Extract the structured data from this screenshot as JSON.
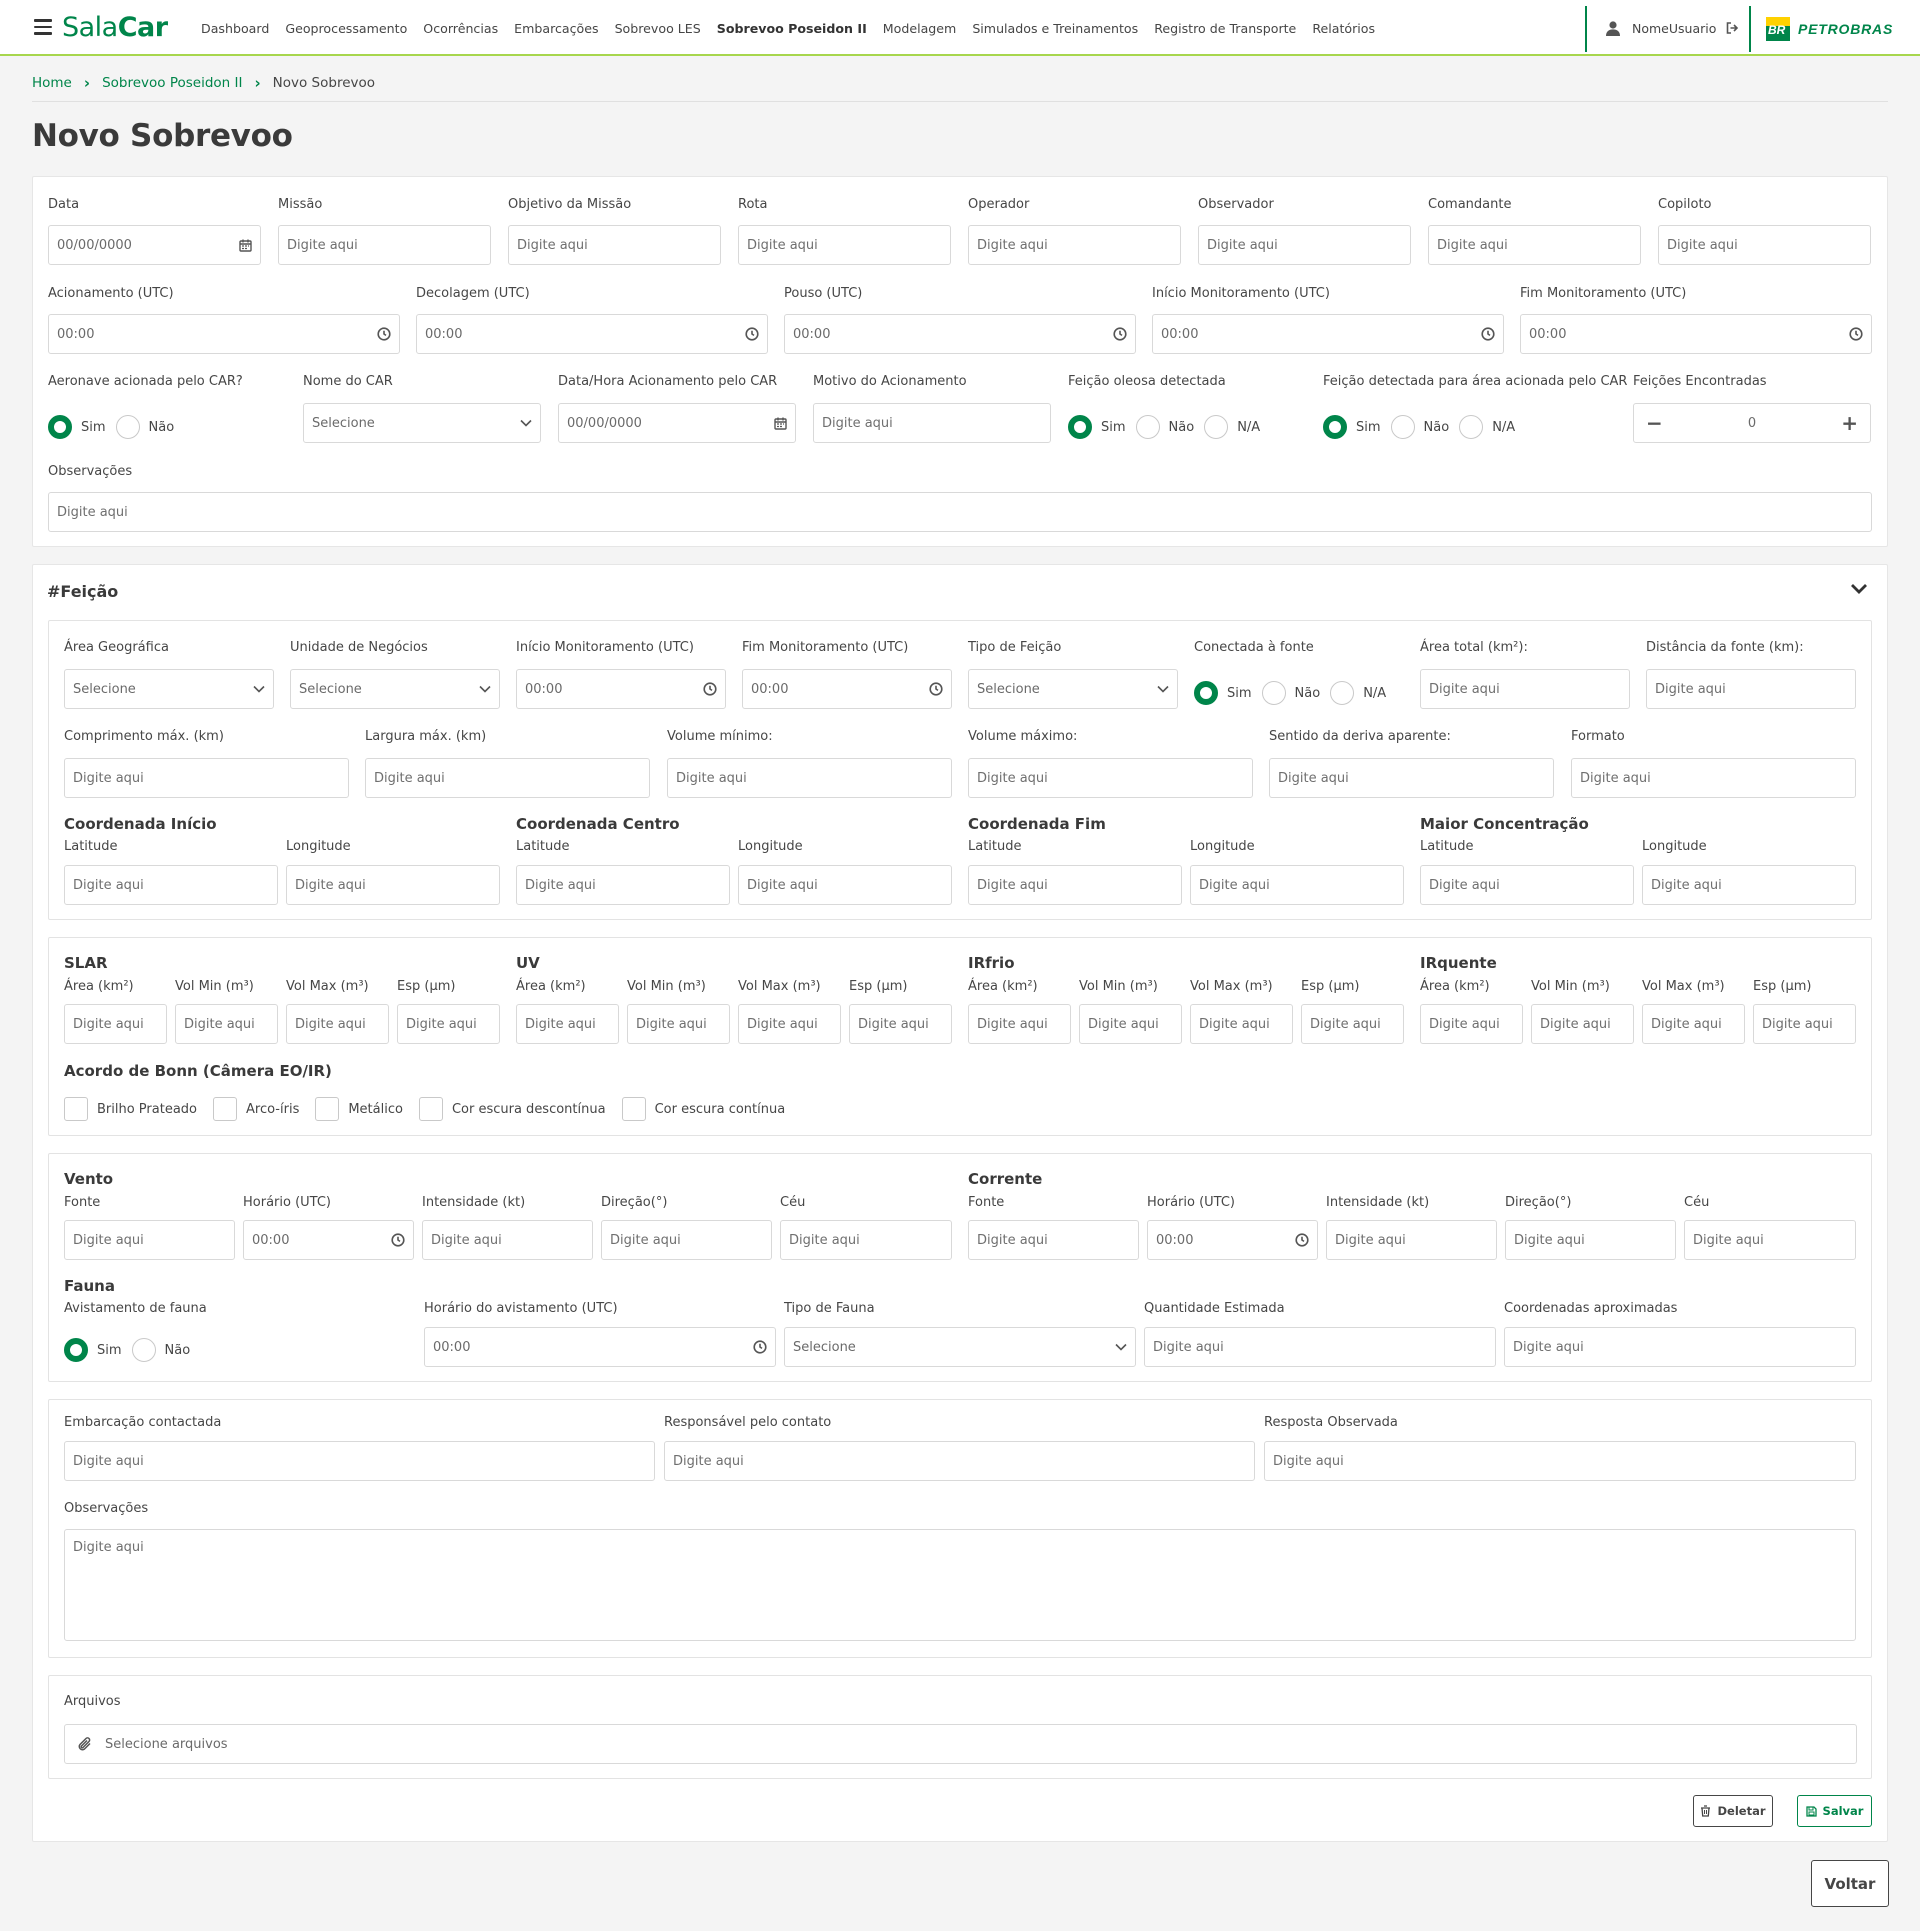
{
  "header": {
    "app_name_light": "Sala",
    "app_name_bold": "Car",
    "nav": [
      "Dashboard",
      "Geoprocessamento",
      "Ocorrências",
      "Embarcações",
      "Sobrevoo LES",
      "Sobrevoo Poseidon II",
      "Modelagem",
      "Simulados e Treinamentos",
      "Registro de Transporte",
      "Relatórios"
    ],
    "active_nav": "Sobrevoo Poseidon II",
    "user_name": "NomeUsuario",
    "brand_badge": "BR",
    "brand_name": "PETROBRAS",
    "colors": {
      "primary": "#00854a",
      "accent": "#a7d64d",
      "brand_yellow": "#ffd100"
    }
  },
  "breadcrumb": {
    "home": "Home",
    "parent": "Sobrevoo Poseidon II",
    "current": "Novo Sobrevoo"
  },
  "page_title": "Novo Sobrevoo",
  "common": {
    "placeholder": "Digite aqui",
    "select_placeholder": "Selecione",
    "date_placeholder": "00/00/0000",
    "time_placeholder": "00:00"
  },
  "main": {
    "data": "Data",
    "missao": "Missão",
    "objetivo": "Objetivo da Missão",
    "rota": "Rota",
    "operador": "Operador",
    "observador": "Observador",
    "comandante": "Comandante",
    "copiloto": "Copiloto",
    "acionamento": "Acionamento (UTC)",
    "decolagem": "Decolagem (UTC)",
    "pouso": "Pouso (UTC)",
    "inicio_monit": "Início Monitoramento (UTC)",
    "fim_monit": "Fim Monitoramento (UTC)",
    "aeronave_acionada": "Aeronave acionada pelo CAR?",
    "nome_car": "Nome do CAR",
    "data_hora_acionamento": "Data/Hora Acionamento pelo CAR",
    "motivo": "Motivo do Acionamento",
    "feicao_oleosa": "Feição oleosa detectada",
    "feicao_area": "Feição detectada para área acionada pelo CAR",
    "feicoes_encontradas": "Feições Encontradas",
    "feicoes_count": "0",
    "observacoes": "Observações"
  },
  "options": {
    "sim": "Sim",
    "nao": "Não",
    "na": "N/A"
  },
  "feicao": {
    "section_title": "#Feição",
    "area_geografica": "Área Geográfica",
    "unidade_negocios": "Unidade de Negócios",
    "inicio_monit": "Início Monitoramento (UTC)",
    "fim_monit": "Fim Monitoramento (UTC)",
    "tipo_feicao": "Tipo de Feição",
    "conectada_fonte": "Conectada à fonte",
    "area_total": "Área total (km²):",
    "distancia_fonte": "Distância da fonte (km):",
    "comprimento": "Comprimento máx. (km)",
    "largura": "Largura máx. (km)",
    "vol_min": "Volume mínimo:",
    "vol_max": "Volume máximo:",
    "sentido_deriva": "Sentido da deriva aparente:",
    "formato": "Formato",
    "coord_inicio": "Coordenada Início",
    "coord_centro": "Coordenada Centro",
    "coord_fim": "Coordenada Fim",
    "maior_conc": "Maior Concentração",
    "latitude": "Latitude",
    "longitude": "Longitude"
  },
  "sensores": {
    "groups": [
      "SLAR",
      "UV",
      "IRfrio",
      "IRquente"
    ],
    "cols": [
      "Área (km²)",
      "Vol Min (m³)",
      "Vol Max (m³)",
      "Esp (µm)"
    ],
    "bonn_title": "Acordo de Bonn (Câmera EO/IR)",
    "bonn_options": [
      "Brilho Prateado",
      "Arco-íris",
      "Metálico",
      "Cor escura descontínua",
      "Cor escura contínua"
    ]
  },
  "meteo": {
    "vento": "Vento",
    "corrente": "Corrente",
    "cols": [
      "Fonte",
      "Horário (UTC)",
      "Intensidade (kt)",
      "Direção(°)",
      "Céu"
    ],
    "fauna": "Fauna",
    "avistamento": "Avistamento de fauna",
    "horario_avist": "Horário do avistamento (UTC)",
    "tipo_fauna": "Tipo de Fauna",
    "qtd_estimada": "Quantidade Estimada",
    "coord_aprox": "Coordenadas aproximadas"
  },
  "contato": {
    "embarcacao": "Embarcação contactada",
    "responsavel": "Responsável pelo contato",
    "resposta": "Resposta Observada",
    "observacoes": "Observações"
  },
  "arquivos": {
    "label": "Arquivos",
    "button": "Selecione arquivos"
  },
  "actions": {
    "delete": "Deletar",
    "save": "Salvar",
    "back": "Voltar"
  }
}
